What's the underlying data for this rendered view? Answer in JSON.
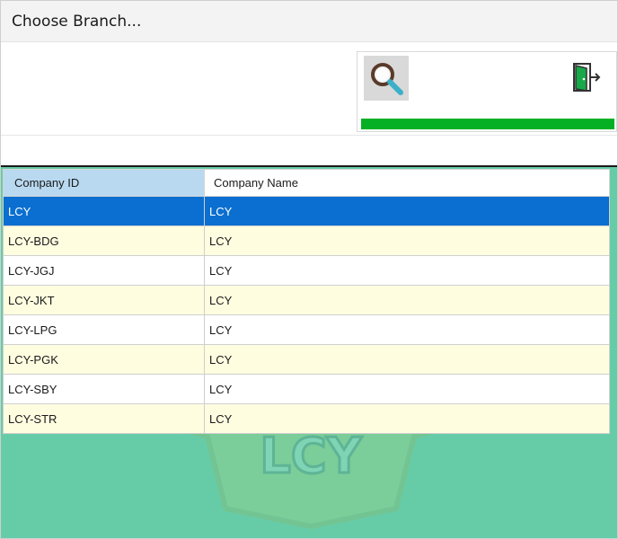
{
  "window": {
    "title": "Choose Branch..."
  },
  "toolbar": {
    "search_icon": "magnifier-icon",
    "exit_icon": "exit-door-icon",
    "progress": 1.0,
    "progress_color": "#06b025"
  },
  "grid": {
    "columns": [
      "Company ID",
      "Company Name"
    ],
    "rows": [
      {
        "id": "LCY",
        "name": "LCY",
        "selected": true
      },
      {
        "id": "LCY-BDG",
        "name": "LCY"
      },
      {
        "id": "LCY-JGJ",
        "name": "LCY"
      },
      {
        "id": "LCY-JKT",
        "name": "LCY"
      },
      {
        "id": "LCY-LPG",
        "name": "LCY"
      },
      {
        "id": "LCY-PGK",
        "name": "LCY"
      },
      {
        "id": "LCY-SBY",
        "name": "LCY"
      },
      {
        "id": "LCY-STR",
        "name": "LCY"
      }
    ],
    "background_color": "#66cca8",
    "selected_color": "#0a6fd0",
    "alt_row_color": "#fffde0"
  },
  "watermark": {
    "text": "LCY"
  }
}
